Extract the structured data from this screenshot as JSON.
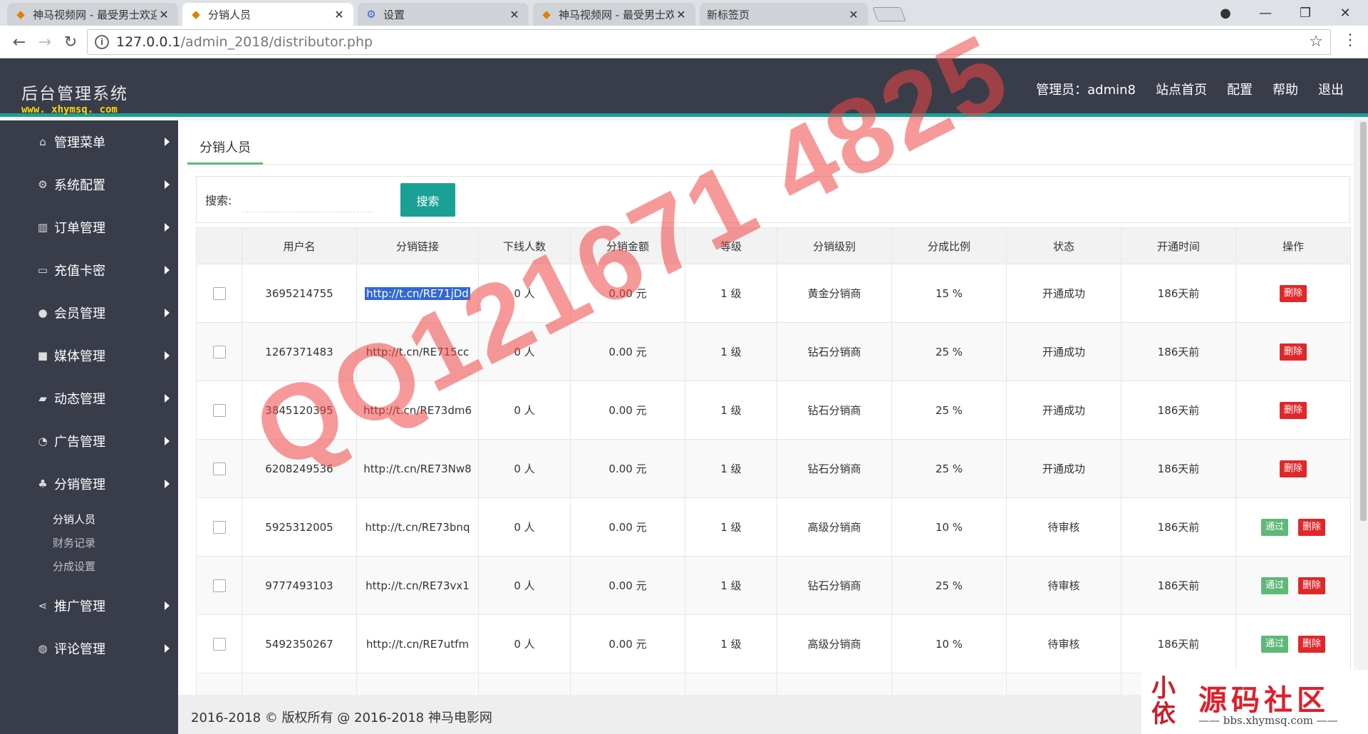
{
  "browser": {
    "tabs": [
      {
        "title": "神马视频网 - 最受男士欢迎",
        "icon": "site-logo-icon",
        "active": false
      },
      {
        "title": "分销人员",
        "icon": "site-logo-icon",
        "active": true
      },
      {
        "title": "设置",
        "icon": "gear-icon",
        "active": false
      },
      {
        "title": "神马视频网 - 最受男士欢迎",
        "icon": "site-logo-icon",
        "active": false
      },
      {
        "title": "新标签页",
        "icon": "none",
        "active": false
      }
    ],
    "url_host": "127.0.0.1",
    "url_path": "/admin_2018/distributor.php"
  },
  "header": {
    "title": "后台管理系统",
    "subtitle": "www. xhymsq. com",
    "admin_label": "管理员：admin8",
    "nav": [
      "站点首页",
      "配置",
      "帮助",
      "退出"
    ]
  },
  "sidebar": {
    "items": [
      {
        "label": "管理菜单",
        "icon": "home-icon"
      },
      {
        "label": "系统配置",
        "icon": "gears-icon"
      },
      {
        "label": "订单管理",
        "icon": "bar-chart-icon"
      },
      {
        "label": "充值卡密",
        "icon": "credit-card-icon"
      },
      {
        "label": "会员管理",
        "icon": "user-icon"
      },
      {
        "label": "媒体管理",
        "icon": "video-camera-icon"
      },
      {
        "label": "动态管理",
        "icon": "book-icon"
      },
      {
        "label": "广告管理",
        "icon": "rss-icon"
      },
      {
        "label": "分销管理",
        "icon": "sitemap-icon"
      }
    ],
    "submenu": [
      "分销人员",
      "财务记录",
      "分成设置"
    ],
    "items_after": [
      {
        "label": "推广管理",
        "icon": "share-icon"
      },
      {
        "label": "评论管理",
        "icon": "comment-icon"
      }
    ]
  },
  "main": {
    "tab": "分销人员",
    "search_label": "搜索:",
    "search_placeholder": "",
    "search_button": "搜索",
    "columns": [
      "",
      "用户名",
      "分销链接",
      "下线人数",
      "分销金额",
      "等级",
      "分销级别",
      "分成比例",
      "状态",
      "开通时间",
      "操作"
    ],
    "rows": [
      {
        "username": "3695214755",
        "link": "http://t.cn/RE71jDd",
        "downline": "0 人",
        "amount": "0.00 元",
        "grade": "1 级",
        "level": "黄金分销商",
        "ratio": "15 %",
        "status": "开通成功",
        "opened": "186天前",
        "actions": [
          "删除"
        ]
      },
      {
        "username": "1267371483",
        "link": "http://t.cn/RE715cc",
        "downline": "0 人",
        "amount": "0.00 元",
        "grade": "1 级",
        "level": "钻石分销商",
        "ratio": "25 %",
        "status": "开通成功",
        "opened": "186天前",
        "actions": [
          "删除"
        ]
      },
      {
        "username": "3845120395",
        "link": "http://t.cn/RE73dm6",
        "downline": "0 人",
        "amount": "0.00 元",
        "grade": "1 级",
        "level": "钻石分销商",
        "ratio": "25 %",
        "status": "开通成功",
        "opened": "186天前",
        "actions": [
          "删除"
        ]
      },
      {
        "username": "6208249536",
        "link": "http://t.cn/RE73Nw8",
        "downline": "0 人",
        "amount": "0.00 元",
        "grade": "1 级",
        "level": "钻石分销商",
        "ratio": "25 %",
        "status": "开通成功",
        "opened": "186天前",
        "actions": [
          "删除"
        ]
      },
      {
        "username": "5925312005",
        "link": "http://t.cn/RE73bnq",
        "downline": "0 人",
        "amount": "0.00 元",
        "grade": "1 级",
        "level": "高级分销商",
        "ratio": "10 %",
        "status": "待审核",
        "opened": "186天前",
        "actions": [
          "通过",
          "删除"
        ]
      },
      {
        "username": "9777493103",
        "link": "http://t.cn/RE73vx1",
        "downline": "0 人",
        "amount": "0.00 元",
        "grade": "1 级",
        "level": "钻石分销商",
        "ratio": "25 %",
        "status": "待审核",
        "opened": "186天前",
        "actions": [
          "通过",
          "删除"
        ]
      },
      {
        "username": "5492350267",
        "link": "http://t.cn/RE7utfm",
        "downline": "0 人",
        "amount": "0.00 元",
        "grade": "1 级",
        "level": "高级分销商",
        "ratio": "10 %",
        "status": "待审核",
        "opened": "186天前",
        "actions": [
          "通过",
          "删除"
        ]
      }
    ]
  },
  "footer": {
    "text": "2016-2018 © 版权所有 @ 2016-2018 神马电影网"
  },
  "watermarks": {
    "diagonal": "QQ121671 4825",
    "logo_title": "源码社区",
    "logo_sub": "—— bbs.xhymsq.com ——",
    "logo_seal": "小依"
  },
  "colors": {
    "accent": "#1aa094",
    "header_bg": "#393d49",
    "delete": "#e0282b",
    "approve": "#5fb878"
  }
}
